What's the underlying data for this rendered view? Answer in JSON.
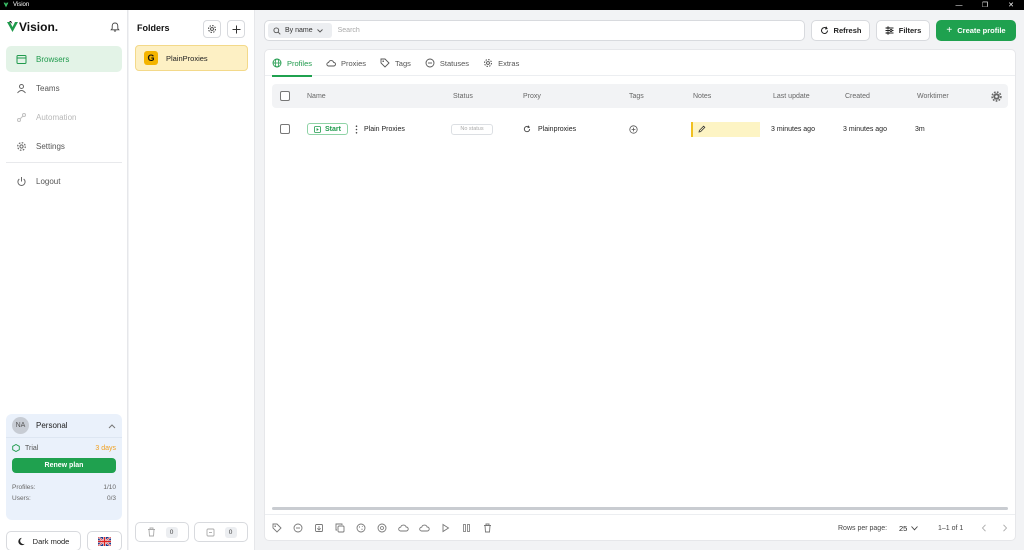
{
  "window": {
    "title": "Vision",
    "controls": {
      "minimize": "—",
      "maximize": "❐",
      "close": "✕"
    }
  },
  "brand": {
    "name": "Vision."
  },
  "nav": {
    "browsers": "Browsers",
    "teams": "Teams",
    "automation": "Automation",
    "settings": "Settings",
    "logout": "Logout"
  },
  "plan": {
    "avatar": "NA",
    "name": "Personal",
    "trial_label": "Trial",
    "trial_days": "3 days",
    "renew_label": "Renew plan",
    "profiles_label": "Profiles:",
    "profiles_value": "1/10",
    "users_label": "Users:",
    "users_value": "0/3"
  },
  "footer_left": {
    "dark_mode": "Dark mode"
  },
  "folders": {
    "title": "Folders",
    "items": [
      {
        "badge": "G",
        "name": "PlainProxies"
      }
    ],
    "trash_count": "0",
    "archive_count": "0"
  },
  "toolbar": {
    "search_mode": "By name",
    "search_placeholder": "Search",
    "search_value": "",
    "refresh": "Refresh",
    "filters": "Filters",
    "create": "Create profile"
  },
  "tabs": [
    "Profiles",
    "Proxies",
    "Tags",
    "Statuses",
    "Extras"
  ],
  "table": {
    "headers": {
      "name": "Name",
      "status": "Status",
      "proxy": "Proxy",
      "tags": "Tags",
      "notes": "Notes",
      "last_update": "Last update",
      "created": "Created",
      "worktimer": "Worktimer"
    },
    "rows": [
      {
        "start": "Start",
        "name": "Plain Proxies",
        "status": "No status",
        "proxy": "Plainproxies",
        "last_update": "3 minutes ago",
        "created": "3 minutes ago",
        "worktimer": "3m"
      }
    ]
  },
  "pagination": {
    "rows_per_page_label": "Rows per page:",
    "rows_per_page": "25",
    "range": "1–1 of 1"
  },
  "colors": {
    "accent": "#1fa14f",
    "active_bg": "#e3f3e7",
    "folder_bg": "#fdf0c4",
    "note_bg": "#fdf4c4"
  }
}
